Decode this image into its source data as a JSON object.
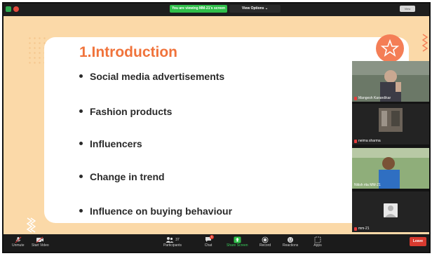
{
  "topbar": {
    "banner": "You are viewing MM-21's screen",
    "view_options": "View Options ⌄",
    "view_button": "View"
  },
  "slide": {
    "title": "1.Introduction",
    "bullets": [
      "Social media advertisements",
      "Fashion products",
      "Influencers",
      "Change in trend",
      "Influence on buying behaviour"
    ]
  },
  "gallery": {
    "tiles": [
      {
        "name": "Mangesh Karandikar",
        "muted": true
      },
      {
        "name": "neima sharma",
        "muted": true
      },
      {
        "name": "Nitish rita MM-21",
        "muted": false
      },
      {
        "name": "mm-21",
        "muted": true
      }
    ]
  },
  "toolbar": {
    "unmute": "Unmute",
    "start_video": "Start Video",
    "participants_count": "37",
    "participants": "Participants",
    "chat_badge": "5",
    "chat": "Chat",
    "share_screen": "Share Screen",
    "record": "Record",
    "reactions": "Reactions",
    "apps": "Apps",
    "leave": "Leave"
  },
  "colors": {
    "slide_bg": "#fbd9a8",
    "title": "#f0733b",
    "share_green": "#2fbf4a",
    "leave_red": "#d83a2f"
  }
}
